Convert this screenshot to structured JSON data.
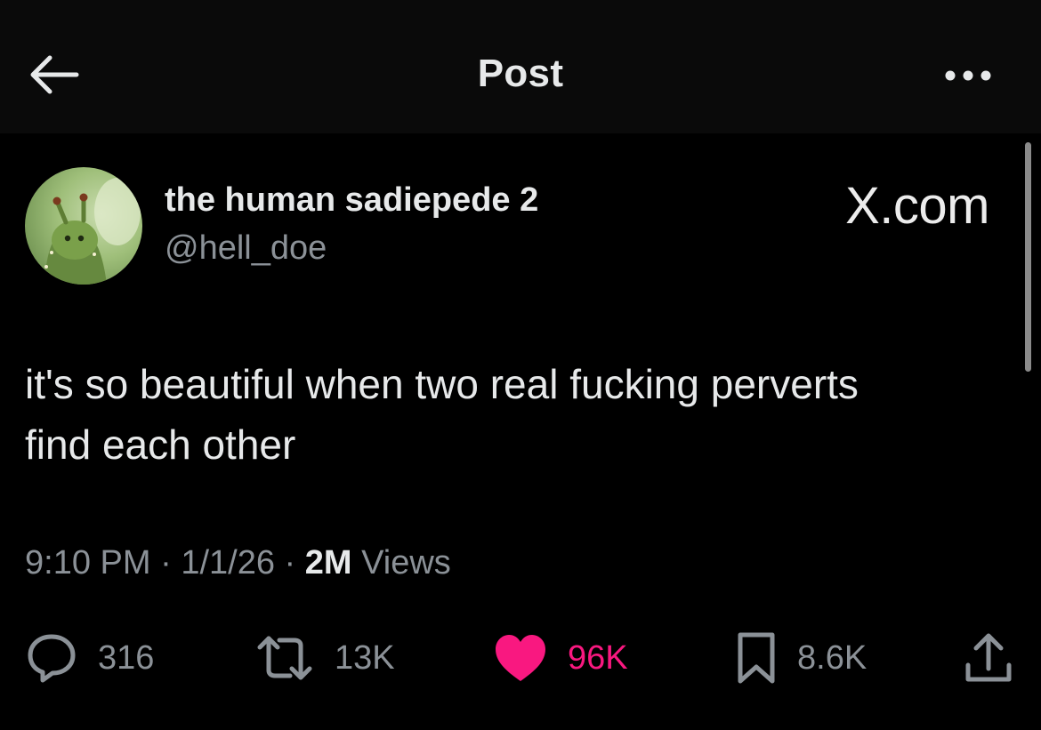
{
  "header": {
    "title": "Post",
    "back_icon": "arrow-left-icon",
    "more_icon": "more-horizontal-icon"
  },
  "author": {
    "display_name": "the human sadiepede 2",
    "handle": "@hell_doe"
  },
  "watermark": "X.com",
  "tweet": {
    "lines": [
      "it's so beautiful when two real fucking perverts",
      "find each other"
    ]
  },
  "meta": {
    "time": "9:10 PM",
    "separator": "·",
    "date": "1/1/26",
    "views_count": "2M",
    "views_label": "Views"
  },
  "actions": {
    "replies": "316",
    "reposts": "13K",
    "likes": "96K",
    "bookmarks": "8.6K"
  },
  "colors": {
    "background": "#000000",
    "header_background": "#0a0a0a",
    "text_primary": "#e7e9ea",
    "text_secondary": "#8b9197",
    "like_pink": "#f91880"
  }
}
